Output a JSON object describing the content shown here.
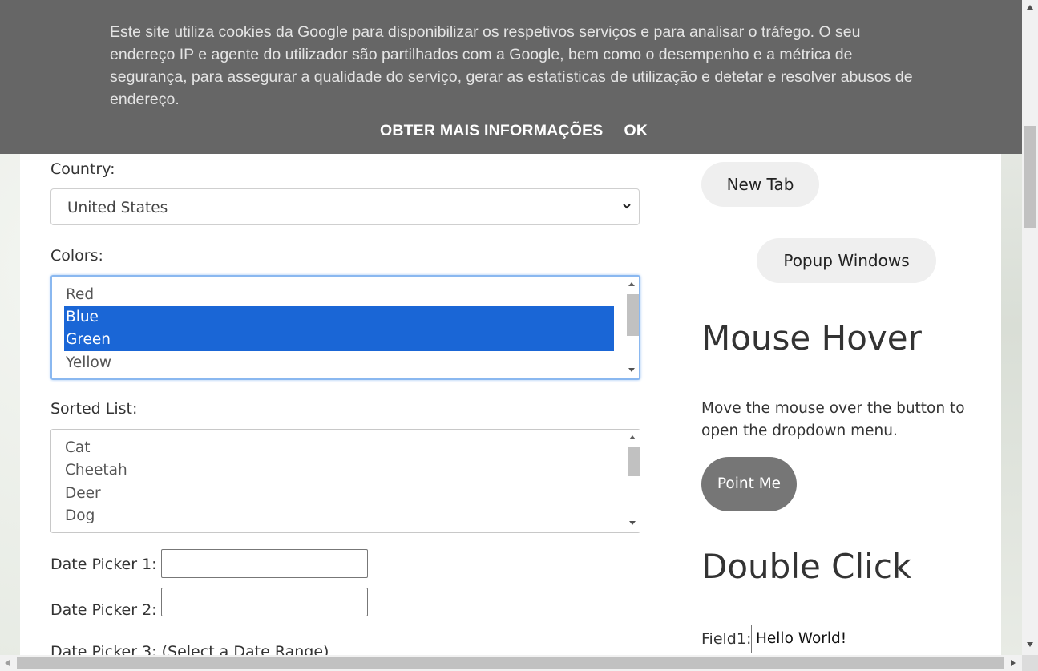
{
  "cookie_banner": {
    "text": "Este site utiliza cookies da Google para disponibilizar os respetivos serviços e para analisar o tráfego. O seu endereço IP e agente do utilizador são partilhados com a Google, bem como o desempenho e a métrica de segurança, para assegurar a qualidade do serviço, gerar as estatísticas de utilização e detetar e resolver abusos de endereço.",
    "more_info_label": "OBTER MAIS INFORMAÇÕES",
    "ok_label": "OK"
  },
  "form": {
    "country_label": "Country:",
    "country_value": "United States",
    "colors_label": "Colors:",
    "colors_options": [
      {
        "label": "Red",
        "selected": false
      },
      {
        "label": "Blue",
        "selected": true
      },
      {
        "label": "Green",
        "selected": true
      },
      {
        "label": "Yellow",
        "selected": false
      }
    ],
    "sorted_label": "Sorted List:",
    "sorted_options": [
      "Cat",
      "Cheetah",
      "Deer",
      "Dog"
    ],
    "date1_label": "Date Picker 1:",
    "date1_value": "",
    "date2_label": "Date Picker 2:",
    "date2_value": "",
    "date3_label": "Date Picker 3: (Select a Date Range)"
  },
  "sidebar": {
    "new_tab_label": "New Tab",
    "popup_label": "Popup Windows",
    "mouse_hover_heading": "Mouse Hover",
    "mouse_hover_text": "Move the mouse over the button to open the dropdown menu.",
    "point_me_label": "Point Me",
    "double_click_heading": "Double Click",
    "field1_label": "Field1:",
    "field1_value": "Hello World!"
  },
  "colors": {
    "selected_option_bg": "#1a66d6",
    "banner_bg": "#666666",
    "point_me_bg": "#767676"
  }
}
